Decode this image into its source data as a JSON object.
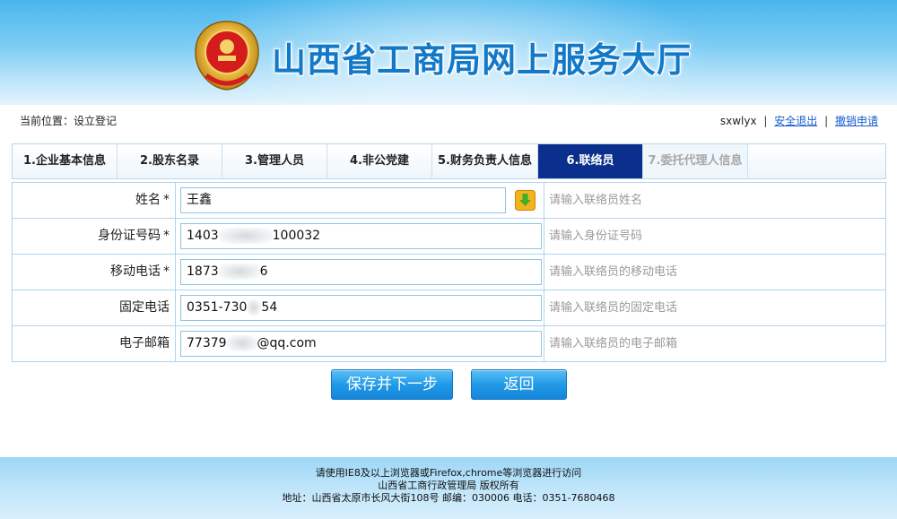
{
  "header": {
    "title": "山西省工商局网上服务大厅",
    "emblem_icon": "national-emblem-icon"
  },
  "location": {
    "text": "当前位置：设立登记"
  },
  "user": {
    "name": "sxwlyx",
    "logout": "安全退出",
    "separator": "|",
    "revoke": "撤销申请"
  },
  "tabs": [
    {
      "label": "1.企业基本信息",
      "state": "normal"
    },
    {
      "label": "2.股东名录",
      "state": "normal"
    },
    {
      "label": "3.管理人员",
      "state": "normal"
    },
    {
      "label": "4.非公党建",
      "state": "normal"
    },
    {
      "label": "5.财务负责人信息",
      "state": "normal"
    },
    {
      "label": "6.联络员",
      "state": "active"
    },
    {
      "label": "7.委托代理人信息",
      "state": "disabled"
    }
  ],
  "form": {
    "name": {
      "label": "姓名",
      "required": "*",
      "value": "王鑫",
      "hint": "请输入联络员姓名",
      "picker_icon": "download-arrow-icon"
    },
    "id_number": {
      "label": "身份证号码",
      "required": "*",
      "value_prefix": "1403",
      "value_suffix": "100032",
      "hint": "请输入身份证号码"
    },
    "mobile": {
      "label": "移动电话",
      "required": "*",
      "value_prefix": "1873",
      "value_suffix": "6",
      "hint": "请输入联络员的移动电话"
    },
    "phone": {
      "label": "固定电话",
      "value_prefix": "0351-730",
      "value_suffix": "54",
      "hint": "请输入联络员的固定电话"
    },
    "email": {
      "label": "电子邮箱",
      "value_prefix": "77379",
      "value_suffix": "@qq.com",
      "hint": "请输入联络员的电子邮箱"
    }
  },
  "buttons": {
    "save_next": "保存并下一步",
    "back": "返回"
  },
  "footer": {
    "line1": "请使用IE8及以上浏览器或Firefox,chrome等浏览器进行访问",
    "line2": "山西省工商行政管理局 版权所有",
    "line3": "地址：山西省太原市长风大街108号 邮编：030006 电话：0351-7680468"
  },
  "colors": {
    "active_tab": "#0b2f8c",
    "button": "#229ae8",
    "link": "#1a5fd0",
    "title": "#1279c9"
  }
}
